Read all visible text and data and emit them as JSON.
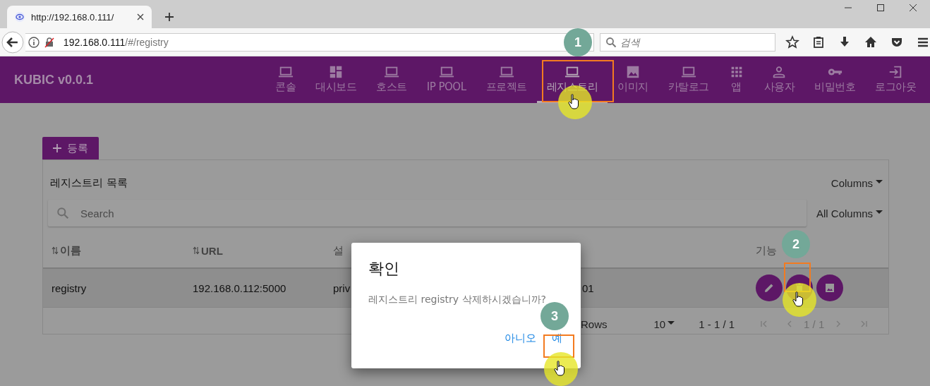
{
  "browser": {
    "tab_title": "http://192.168.0.111/",
    "address_host": "192.168.0.111",
    "address_path": "/#/registry",
    "search_placeholder": "검색"
  },
  "app": {
    "title": "KUBIC v0.0.1",
    "nav": [
      {
        "label": "콘솔",
        "selected": false
      },
      {
        "label": "대시보드",
        "selected": false
      },
      {
        "label": "호스트",
        "selected": false
      },
      {
        "label": "IP POOL",
        "selected": false
      },
      {
        "label": "프로젝트",
        "selected": false
      },
      {
        "label": "레지스트리",
        "selected": true
      },
      {
        "label": "이미지",
        "selected": false
      },
      {
        "label": "카탈로그",
        "selected": false
      },
      {
        "label": "앱",
        "selected": false
      },
      {
        "label": "사용자",
        "selected": false
      },
      {
        "label": "비밀번호",
        "selected": false
      },
      {
        "label": "로그아웃",
        "selected": false
      }
    ]
  },
  "add_button": "등록",
  "list": {
    "title": "레지스트리 목록",
    "columns_menu": "Columns",
    "search_placeholder": "Search",
    "filter_menu": "All Columns",
    "columns": [
      {
        "label": "이름",
        "sortable": true
      },
      {
        "label": "URL",
        "sortable": true
      },
      {
        "label": "설",
        "sortable": false
      },
      {
        "label": "기능",
        "sortable": false
      }
    ],
    "rows": [
      {
        "cells": [
          "registry",
          "192.168.0.112:5000",
          "priv",
          "01"
        ],
        "selected": true
      }
    ],
    "rows_label": "Rows",
    "rows_per_page": "10",
    "range": "1 - 1 / 1",
    "page": "1 / 1"
  },
  "dialog": {
    "title": "확인",
    "message": "레지스트리 registry 삭제하시겠습니까?",
    "buttons": [
      {
        "label": "아니오"
      },
      {
        "label": "예"
      }
    ]
  },
  "callouts": [
    {
      "number": "1"
    },
    {
      "number": "2"
    },
    {
      "number": "3"
    }
  ]
}
